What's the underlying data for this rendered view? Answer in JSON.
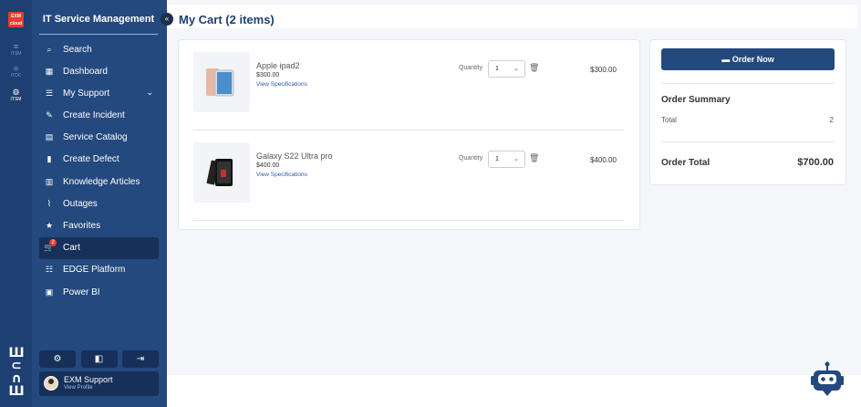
{
  "rail": {
    "logo_text": "EXM cloud",
    "items": [
      {
        "glyph": "≡",
        "label": "ITSM"
      },
      {
        "glyph": "⚛",
        "label": "ITOC"
      },
      {
        "glyph": "⚙",
        "label": "ITSM"
      }
    ],
    "brand_text": "EDGE"
  },
  "sidebar": {
    "title": "IT Service Management",
    "collapse_glyph": "«",
    "items": [
      {
        "icon": "search-icon",
        "glyph": "⌕",
        "label": "Search"
      },
      {
        "icon": "dashboard-icon",
        "glyph": "▦",
        "label": "Dashboard"
      },
      {
        "icon": "support-icon",
        "glyph": "☰",
        "label": "My Support",
        "chevron": "⌄"
      },
      {
        "icon": "incident-icon",
        "glyph": "✎",
        "label": "Create Incident"
      },
      {
        "icon": "catalog-icon",
        "glyph": "▤",
        "label": "Service Catalog"
      },
      {
        "icon": "defect-icon",
        "glyph": "▮",
        "label": "Create Defect"
      },
      {
        "icon": "book-icon",
        "glyph": "▥",
        "label": "Knowledge Articles"
      },
      {
        "icon": "outage-icon",
        "glyph": "⌇",
        "label": "Outages"
      },
      {
        "icon": "star-icon",
        "glyph": "★",
        "label": "Favorites"
      },
      {
        "icon": "cart-icon",
        "glyph": "🛒",
        "label": "Cart",
        "badge": "2"
      },
      {
        "icon": "database-icon",
        "glyph": "☷",
        "label": "EDGE Platform"
      },
      {
        "icon": "powerbi-icon",
        "glyph": "▣",
        "label": "Power BI"
      }
    ],
    "bottom_buttons": [
      {
        "icon": "settings-icon",
        "glyph": "⚙"
      },
      {
        "icon": "theme-icon",
        "glyph": "◧"
      },
      {
        "icon": "logout-icon",
        "glyph": "⇥"
      }
    ],
    "profile": {
      "name": "EXM Support",
      "link": "View Profile"
    }
  },
  "header": {
    "title": "My Cart (2 items)"
  },
  "cart": {
    "items": [
      {
        "name": "Apple ipad2",
        "price": "$300.00",
        "spec_link": "View Specifications",
        "qty_label": "Quantity",
        "qty": "1",
        "total": "$300.00"
      },
      {
        "name": "Galaxy S22 Ultra pro",
        "price": "$400.00",
        "spec_link": "View Specifications",
        "qty_label": "Quantity",
        "qty": "1",
        "total": "$400.00"
      }
    ]
  },
  "summary": {
    "order_button": "Order Now",
    "title": "Order Summary",
    "total_label": "Total",
    "total_count": "2",
    "order_total_label": "Order Total",
    "order_total_value": "$700.00"
  },
  "colors": {
    "sidebar": "#24497f",
    "rail": "#1e3f72",
    "accent": "#24497f",
    "badge": "#e63b2e"
  }
}
